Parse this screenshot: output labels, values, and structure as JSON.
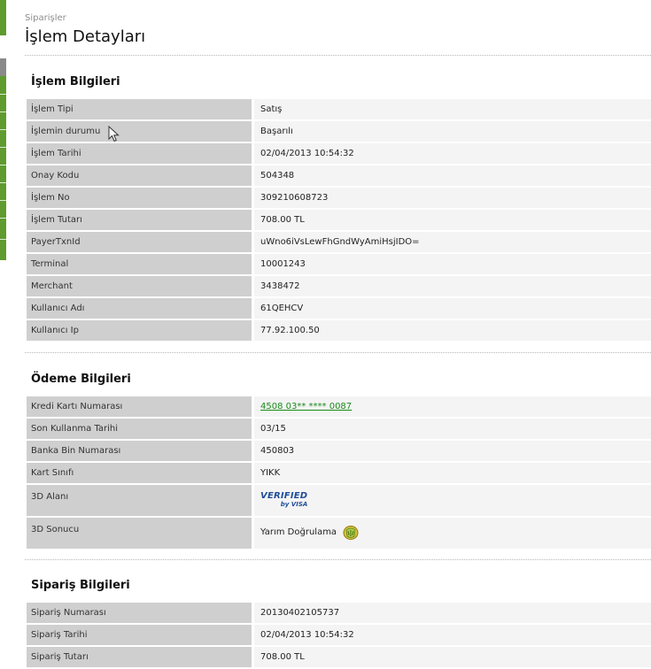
{
  "breadcrumb": "Siparişler",
  "title": "İşlem Detayları",
  "sections": {
    "islem": {
      "title": "İşlem Bilgileri",
      "rows": [
        {
          "label": "İşlem Tipi",
          "value": "Satış"
        },
        {
          "label": "İşlemin durumu",
          "value": "Başarılı"
        },
        {
          "label": "İşlem Tarihi",
          "value": "02/04/2013 10:54:32"
        },
        {
          "label": "Onay Kodu",
          "value": "504348"
        },
        {
          "label": "İşlem No",
          "value": "309210608723"
        },
        {
          "label": "İşlem Tutarı",
          "value": "708.00 TL"
        },
        {
          "label": "PayerTxnId",
          "value": "uWno6iVsLewFhGndWyAmiHsjIDO="
        },
        {
          "label": "Terminal",
          "value": "10001243"
        },
        {
          "label": "Merchant",
          "value": "3438472"
        },
        {
          "label": "Kullanıcı Adı",
          "value": "61QEHCV"
        },
        {
          "label": "Kullanıcı Ip",
          "value": "77.92.100.50"
        }
      ]
    },
    "odeme": {
      "title": "Ödeme Bilgileri",
      "rows": [
        {
          "label": "Kredi Kartı Numarası",
          "value": "4508 03** **** 0087"
        },
        {
          "label": "Son Kullanma Tarihi",
          "value": "03/15"
        },
        {
          "label": "Banka Bin Numarası",
          "value": "450803"
        },
        {
          "label": "Kart Sınıfı",
          "value": "YIKK"
        },
        {
          "label": "3D Alanı",
          "logo_line1": "VERIFIED",
          "logo_line2": "by VISA"
        },
        {
          "label": "3D Sonucu",
          "value": "Yarım Doğrulama"
        }
      ]
    },
    "siparis": {
      "title": "Sipariş Bilgileri",
      "rows": [
        {
          "label": "Sipariş Numarası",
          "value": "20130402105737"
        },
        {
          "label": "Sipariş Tarihi",
          "value": "02/04/2013 10:54:32"
        },
        {
          "label": "Sipariş Tutarı",
          "value": "708.00 TL"
        }
      ]
    }
  },
  "colors": {
    "sidebar_green": "#5f9b2f",
    "link_green": "#1a8a1a",
    "label_bg": "#cfcfcf",
    "value_bg": "#f4f4f4"
  }
}
